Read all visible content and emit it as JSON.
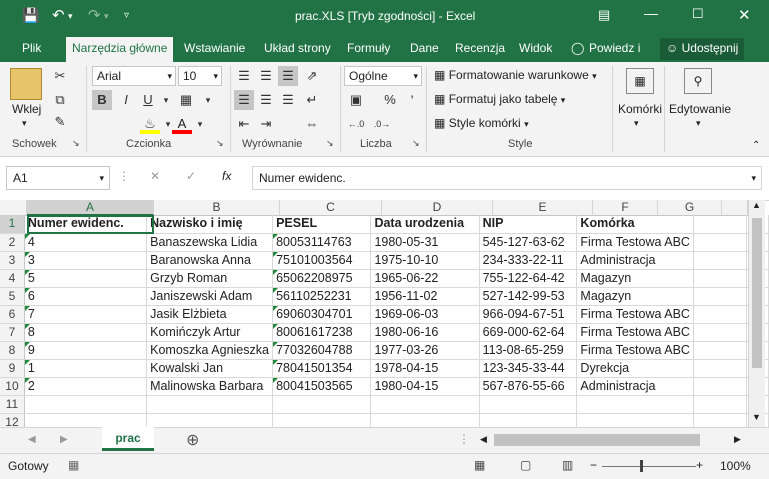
{
  "window": {
    "title": "prac.XLS  [Tryb zgodności]  -  Excel"
  },
  "tabs": [
    "Plik",
    "Narzędzia główne",
    "Wstawianie",
    "Układ strony",
    "Formuły",
    "Dane",
    "Recenzja",
    "Widok"
  ],
  "tell_me": "Powiedz i",
  "share": "Udostępnij",
  "ribbon": {
    "paste": "Wklej",
    "font_name": "Arial",
    "font_size": "10",
    "number_format": "Ogólne",
    "conditional_formatting": "Formatowanie warunkowe",
    "format_as_table": "Formatuj jako tabelę",
    "cell_styles": "Style komórki",
    "cells": "Komórki",
    "editing": "Edytowanie",
    "groups": {
      "clipboard": "Schowek",
      "font": "Czcionka",
      "alignment": "Wyrównanie",
      "number": "Liczba",
      "styles": "Style"
    },
    "bold": "B",
    "italic": "I",
    "underline": "U"
  },
  "formula_bar": {
    "name_box": "A1",
    "fx": "fx",
    "content": "Numer ewidenc."
  },
  "columns": [
    "A",
    "B",
    "C",
    "D",
    "E",
    "F",
    "G"
  ],
  "row_numbers": [
    "1",
    "2",
    "3",
    "4",
    "5",
    "6",
    "7",
    "8",
    "9",
    "10",
    "11",
    "12"
  ],
  "rows": [
    [
      "Numer ewidenc.",
      "Nazwisko i imię",
      "PESEL",
      "Data urodzenia",
      "NIP",
      "Komórka",
      ""
    ],
    [
      "4",
      "Banaszewska Lidia",
      "80053114763",
      "1980-05-31",
      "545-127-63-62",
      "Firma Testowa ABC",
      ""
    ],
    [
      "3",
      "Baranowska Anna",
      "75101003564",
      "1975-10-10",
      "234-333-22-11",
      "Administracja",
      ""
    ],
    [
      "5",
      "Grzyb Roman",
      "65062208975",
      "1965-06-22",
      "755-122-64-42",
      "Magazyn",
      ""
    ],
    [
      "6",
      "Janiszewski Adam",
      "56110252231",
      "1956-11-02",
      "527-142-99-53",
      "Magazyn",
      ""
    ],
    [
      "7",
      "Jasik Elżbieta",
      "69060304701",
      "1969-06-03",
      "966-094-67-51",
      "Firma Testowa ABC",
      ""
    ],
    [
      "8",
      "Komińczyk Artur",
      "80061617238",
      "1980-06-16",
      "669-000-62-64",
      "Firma Testowa ABC",
      ""
    ],
    [
      "9",
      "Komoszka Agnieszka",
      "77032604788",
      "1977-03-26",
      "113-08-65-259",
      "Firma Testowa ABC",
      ""
    ],
    [
      "1",
      "Kowalski Jan",
      "78041501354",
      "1978-04-15",
      "123-345-33-44",
      "Dyrekcja",
      ""
    ],
    [
      "2",
      "Malinowska Barbara",
      "80041503565",
      "1980-04-15",
      "567-876-55-66",
      "Administracja",
      ""
    ],
    [
      "",
      "",
      "",
      "",
      "",
      "",
      ""
    ],
    [
      "",
      "",
      "",
      "",
      "",
      "",
      ""
    ]
  ],
  "sheet_tab": "prac",
  "status": "Gotowy",
  "zoom": "100%",
  "colors": {
    "brand": "#217346",
    "ribbon": "#f3f3f3",
    "error_triangle": "#1e8a3c"
  }
}
